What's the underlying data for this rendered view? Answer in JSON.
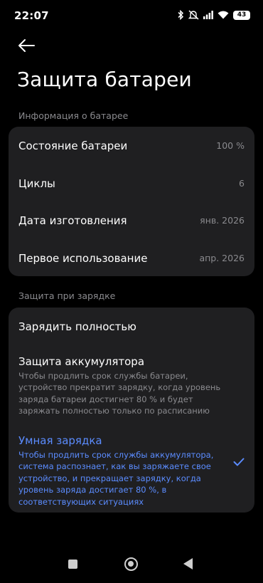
{
  "status_bar": {
    "time": "22:07",
    "battery_level": "43",
    "icons": [
      "bluetooth-icon",
      "mute-icon",
      "signal-icon",
      "wifi-icon",
      "battery-icon"
    ]
  },
  "header": {
    "back_icon": "arrow-left-icon",
    "title": "Защита батареи"
  },
  "battery_info": {
    "section_title": "Информация о батарее",
    "rows": [
      {
        "label": "Состояние батареи",
        "value": "100 %"
      },
      {
        "label": "Циклы",
        "value": "6"
      },
      {
        "label": "Дата изготовления",
        "value": "янв. 2026"
      },
      {
        "label": "Первое использование",
        "value": "апр. 2026"
      }
    ]
  },
  "charging": {
    "section_title": "Защита при зарядке",
    "options": [
      {
        "title": "Зарядить полностью",
        "description": "",
        "selected": false
      },
      {
        "title": "Защита аккумулятора",
        "description": "Чтобы продлить срок службы батареи, устройство прекратит зарядку, когда уровень заряда батареи достигнет 80 % и будет заряжать полностью только по расписанию",
        "selected": false
      },
      {
        "title": "Умная зарядка",
        "description": "Чтобы продлить срок службы аккумулятора, система распознает, как вы заряжаете свое устройство, и прекращает зарядку, когда уровень заряда достигает 80 %, в соответствующих ситуациях",
        "selected": true
      }
    ]
  },
  "colors": {
    "accent": "#5b8cff",
    "card_bg": "#1f1f21",
    "secondary_text": "#8a8a8e"
  },
  "nav_bar": {
    "icons": [
      "recents-icon",
      "home-icon",
      "back-icon"
    ]
  }
}
